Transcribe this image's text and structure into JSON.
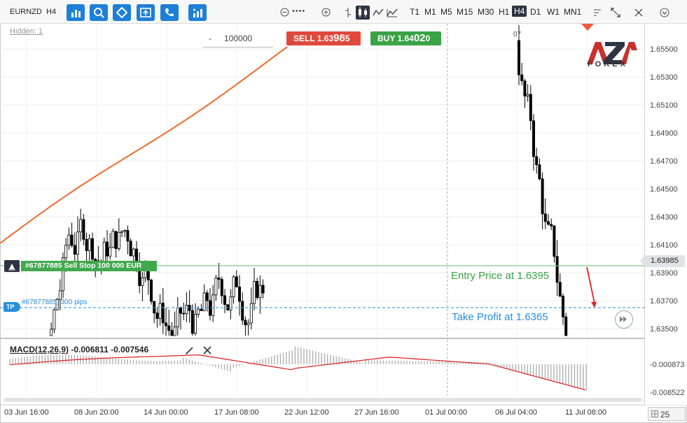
{
  "toolbar": {
    "symbol": "EURNZD",
    "timeframe": "H4",
    "zoom_dots": "••••",
    "timeframes": [
      {
        "label": "T1",
        "active": false
      },
      {
        "label": "M1",
        "active": false
      },
      {
        "label": "M5",
        "active": false
      },
      {
        "label": "M15",
        "active": false
      },
      {
        "label": "M30",
        "active": false
      },
      {
        "label": "H1",
        "active": false
      },
      {
        "label": "H4",
        "active": true
      },
      {
        "label": "D1",
        "active": false
      },
      {
        "label": "W1",
        "active": false
      },
      {
        "label": "MN1",
        "active": false
      }
    ],
    "tool_icons": [
      "chart-type-icon",
      "indicator-icon",
      "drawing-icon",
      "trade-icon",
      "phone-icon",
      "analytics-icon"
    ]
  },
  "chart": {
    "hidden_label": "Hidden: 1",
    "quantity": "100000",
    "quantity_minus": "-",
    "sell_label": "SELL",
    "sell_price_head": "1.63",
    "sell_price_big": "98",
    "sell_price_tail": "5",
    "buy_label": "BUY",
    "buy_price_head": "1.64",
    "buy_price_big": "02",
    "buy_price_tail": "0",
    "current_price": "1.63985",
    "order_label": "#67877885 Sell Stop 100 000 EUR",
    "tp_badge": "TP",
    "tp_label": "#67877885, 300 pips",
    "entry_annotation": "Entry Price at 1.6395",
    "tp_annotation": "Take Profit at 1.6365",
    "logo_sub": "FOREX",
    "top_right_number": "07",
    "colors": {
      "bull": "#ffffff",
      "bear": "#000000",
      "ma": "#f06a2a",
      "entry_line": "#7fc98a",
      "tp_line": "#4aa3e0",
      "sell": "#e0483c",
      "buy": "#3aa345",
      "arrow": "#e22020"
    }
  },
  "y_axis": {
    "labels": [
      "1.65500",
      "1.65300",
      "1.65100",
      "1.64900",
      "1.64700",
      "1.64500",
      "1.64300",
      "1.64100",
      "1.63900",
      "1.63700",
      "1.63500"
    ]
  },
  "macd": {
    "label_name": "MACD(12,26,9)",
    "label_values": "-0.006811 -0.007546",
    "axis_labels": [
      "-0.000873",
      "-0.008522"
    ]
  },
  "x_axis": {
    "labels": [
      "03 Jun 16:00",
      "08 Jun 20:00",
      "14 Jun 00:00",
      "17 Jun 08:00",
      "22 Jun 12:00",
      "27 Jun 16:00",
      "01 Jul 00:00",
      "06 Jul 04:00",
      "11 Jul 08:00"
    ]
  },
  "bottom": {
    "count": "25"
  }
}
